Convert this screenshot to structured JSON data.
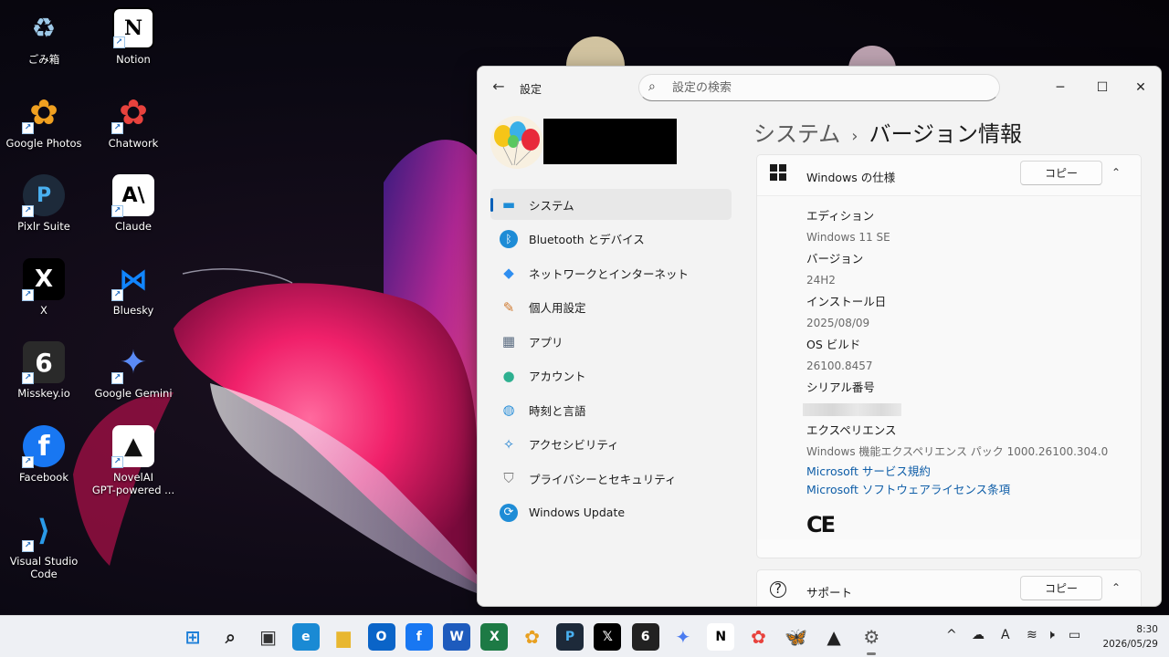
{
  "desktop": {
    "icons": [
      {
        "label": "ごみ箱",
        "icon": "recycle-bin-icon",
        "color": "#9ec9e8",
        "glyph": "♻"
      },
      {
        "label": "Notion",
        "icon": "notion-icon",
        "color": "#ffffff",
        "glyph": "N"
      },
      {
        "label": "Google Photos",
        "icon": "google-photos-icon",
        "color": "#ffffff",
        "glyph": "✿"
      },
      {
        "label": "Chatwork",
        "icon": "chatwork-icon",
        "color": "#e8423d",
        "glyph": "✿"
      },
      {
        "label": "Pixlr Suite",
        "icon": "pixlr-icon",
        "color": "#1d2a3a",
        "glyph": "P"
      },
      {
        "label": "Claude",
        "icon": "claude-icon",
        "color": "#ffffff",
        "glyph": "A\\"
      },
      {
        "label": "X",
        "icon": "x-icon",
        "color": "#000000",
        "glyph": "𝕏"
      },
      {
        "label": "Bluesky",
        "icon": "bluesky-icon",
        "color": "#1185fe",
        "glyph": "🦋"
      },
      {
        "label": "Misskey.io",
        "icon": "misskey-icon",
        "color": "#222222",
        "glyph": "6"
      },
      {
        "label": "Google Gemini",
        "icon": "gemini-icon",
        "color": "#000000",
        "glyph": "✦"
      },
      {
        "label": "Facebook",
        "icon": "facebook-icon",
        "color": "#1877f2",
        "glyph": "f"
      },
      {
        "label": "NovelAI\nGPT-powered ...",
        "icon": "novelai-icon",
        "color": "#ffffff",
        "glyph": "▲"
      },
      {
        "label": "Visual Studio Code",
        "icon": "vscode-icon",
        "color": "#000000",
        "glyph": "⟩"
      }
    ]
  },
  "window": {
    "back_glyph": "←",
    "app_title": "設定",
    "search_placeholder": "設定の検索",
    "minimize_glyph": "─",
    "maximize_glyph": "☐",
    "close_glyph": "✕"
  },
  "nav": {
    "items": [
      {
        "label": "システム",
        "icon": "system-display-icon",
        "glyph": "▬",
        "color": "#1e8cd6"
      },
      {
        "label": "Bluetooth とデバイス",
        "icon": "bluetooth-icon",
        "glyph": "ᛒ",
        "color": "#1e8cd6"
      },
      {
        "label": "ネットワークとインターネット",
        "icon": "wifi-icon",
        "glyph": "◆",
        "color": "#2f8ef0"
      },
      {
        "label": "個人用設定",
        "icon": "paintbrush-icon",
        "glyph": "✎",
        "color": "#d07a30"
      },
      {
        "label": "アプリ",
        "icon": "apps-icon",
        "glyph": "▦",
        "color": "#5a6b80"
      },
      {
        "label": "アカウント",
        "icon": "account-icon",
        "glyph": "●",
        "color": "#2eb090"
      },
      {
        "label": "時刻と言語",
        "icon": "globe-clock-icon",
        "glyph": "◍",
        "color": "#2a8fd8"
      },
      {
        "label": "アクセシビリティ",
        "icon": "accessibility-icon",
        "glyph": "✧",
        "color": "#1d7fd0"
      },
      {
        "label": "プライバシーとセキュリティ",
        "icon": "shield-icon",
        "glyph": "⛉",
        "color": "#7a7a7a"
      },
      {
        "label": "Windows Update",
        "icon": "windows-update-icon",
        "glyph": "⟳",
        "color": "#1e8cd6"
      }
    ]
  },
  "page": {
    "breadcrumb_parent": "システム",
    "breadcrumb_sep": "›",
    "title": "バージョン情報"
  },
  "spec_card": {
    "icon": "windows-logo-icon",
    "title": "Windows の仕様",
    "copy_label": "コピー",
    "chevron": "⌃",
    "fields": [
      {
        "label": "エディション",
        "value": "Windows 11 SE"
      },
      {
        "label": "バージョン",
        "value": "24H2"
      },
      {
        "label": "インストール日",
        "value": "2025/08/09"
      },
      {
        "label": "OS ビルド",
        "value": "26100.8457"
      },
      {
        "label": "シリアル番号",
        "value": ""
      },
      {
        "label": "エクスペリエンス",
        "value": "Windows 機能エクスペリエンス パック 1000.26100.304.0"
      }
    ],
    "links": [
      "Microsoft サービス規約",
      "Microsoft ソフトウェアライセンス条項"
    ],
    "ce_mark": "CE"
  },
  "support_card": {
    "icon": "help-icon",
    "title": "サポート",
    "copy_label": "コピー",
    "chevron": "⌃"
  },
  "taskbar": {
    "apps": [
      {
        "name": "start",
        "icon": "windows-start-icon",
        "glyph": "⊞",
        "bg": "transparent",
        "fg": "#1e7fd8"
      },
      {
        "name": "search",
        "icon": "search-icon",
        "glyph": "⌕",
        "bg": "transparent",
        "fg": "#222222"
      },
      {
        "name": "task-view",
        "icon": "task-view-icon",
        "glyph": "▣",
        "bg": "transparent",
        "fg": "#333333"
      },
      {
        "name": "edge",
        "icon": "edge-icon",
        "glyph": "e",
        "bg": "#1a8ad4",
        "fg": "#ffffff"
      },
      {
        "name": "explorer",
        "icon": "folder-icon",
        "glyph": "▆",
        "bg": "transparent",
        "fg": "#e8b730"
      },
      {
        "name": "outlook",
        "icon": "outlook-icon",
        "glyph": "O",
        "bg": "#0a64c8",
        "fg": "#ffffff"
      },
      {
        "name": "facebook",
        "icon": "facebook-icon",
        "glyph": "f",
        "bg": "#1877f2",
        "fg": "#ffffff"
      },
      {
        "name": "word",
        "icon": "word-icon",
        "glyph": "W",
        "bg": "#1e5bbd",
        "fg": "#ffffff"
      },
      {
        "name": "excel",
        "icon": "excel-icon",
        "glyph": "X",
        "bg": "#1d7a45",
        "fg": "#ffffff"
      },
      {
        "name": "photos",
        "icon": "google-photos-icon",
        "glyph": "✿",
        "bg": "transparent",
        "fg": "#e8a020"
      },
      {
        "name": "pixlr",
        "icon": "pixlr-icon",
        "glyph": "P",
        "bg": "#1d2a3a",
        "fg": "#49b0f0"
      },
      {
        "name": "x",
        "icon": "x-icon",
        "glyph": "𝕏",
        "bg": "#000000",
        "fg": "#ffffff"
      },
      {
        "name": "misskey",
        "icon": "misskey-icon",
        "glyph": "6",
        "bg": "#222222",
        "fg": "#ffffff"
      },
      {
        "name": "gemini",
        "icon": "gemini-icon",
        "glyph": "✦",
        "bg": "transparent",
        "fg": "#4a7bf0"
      },
      {
        "name": "notion",
        "icon": "notion-icon",
        "glyph": "N",
        "bg": "#ffffff",
        "fg": "#000000"
      },
      {
        "name": "chatwork",
        "icon": "chatwork-icon",
        "glyph": "✿",
        "bg": "transparent",
        "fg": "#e8423d"
      },
      {
        "name": "bluesky",
        "icon": "bluesky-icon",
        "glyph": "🦋",
        "bg": "transparent",
        "fg": "#1185fe"
      },
      {
        "name": "novelai",
        "icon": "novelai-icon",
        "glyph": "▲",
        "bg": "transparent",
        "fg": "#222222"
      },
      {
        "name": "settings",
        "icon": "settings-gear-icon",
        "glyph": "⚙",
        "bg": "transparent",
        "fg": "#555555",
        "active": true
      }
    ],
    "tray": [
      {
        "icon": "chevron-up-icon",
        "glyph": "^"
      },
      {
        "icon": "onedrive-icon",
        "glyph": "☁"
      },
      {
        "icon": "ime-icon",
        "glyph": "A"
      },
      {
        "icon": "wifi-icon",
        "glyph": "≋"
      },
      {
        "icon": "speaker-icon",
        "glyph": "🕨"
      },
      {
        "icon": "battery-icon",
        "glyph": "▭"
      }
    ],
    "time": "8:30",
    "date": "2026/05/29"
  }
}
